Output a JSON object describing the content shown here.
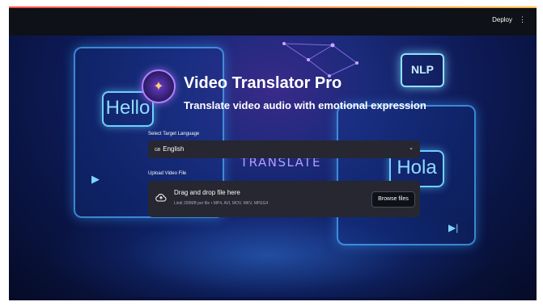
{
  "header": {
    "deploy_label": "Deploy",
    "menu_glyph": "⋮"
  },
  "background": {
    "bubble_left": "Hello",
    "bubble_right": "Hola",
    "chip_label": "NLP",
    "center_text": "TRANSLATE"
  },
  "app": {
    "title": "Video Translator Pro",
    "subtitle": "Translate video audio with emotional expression"
  },
  "language": {
    "label": "Select Target Language",
    "flag": "GB",
    "selected": "English"
  },
  "upload": {
    "label": "Upload Video File",
    "title": "Drag and drop file here",
    "limits": "Limit 200MB per file • MP4, AVI, MOV, MKV, MPEG4",
    "browse_label": "Browse files"
  },
  "icons": [
    "kebab-menu-icon",
    "chevron-down-icon",
    "upload-cloud-icon",
    "play-icon",
    "skip-forward-icon"
  ],
  "colors": {
    "accent_red": "#ff4b4b",
    "widget_bg": "#262730",
    "app_bg": "#0e1117"
  }
}
